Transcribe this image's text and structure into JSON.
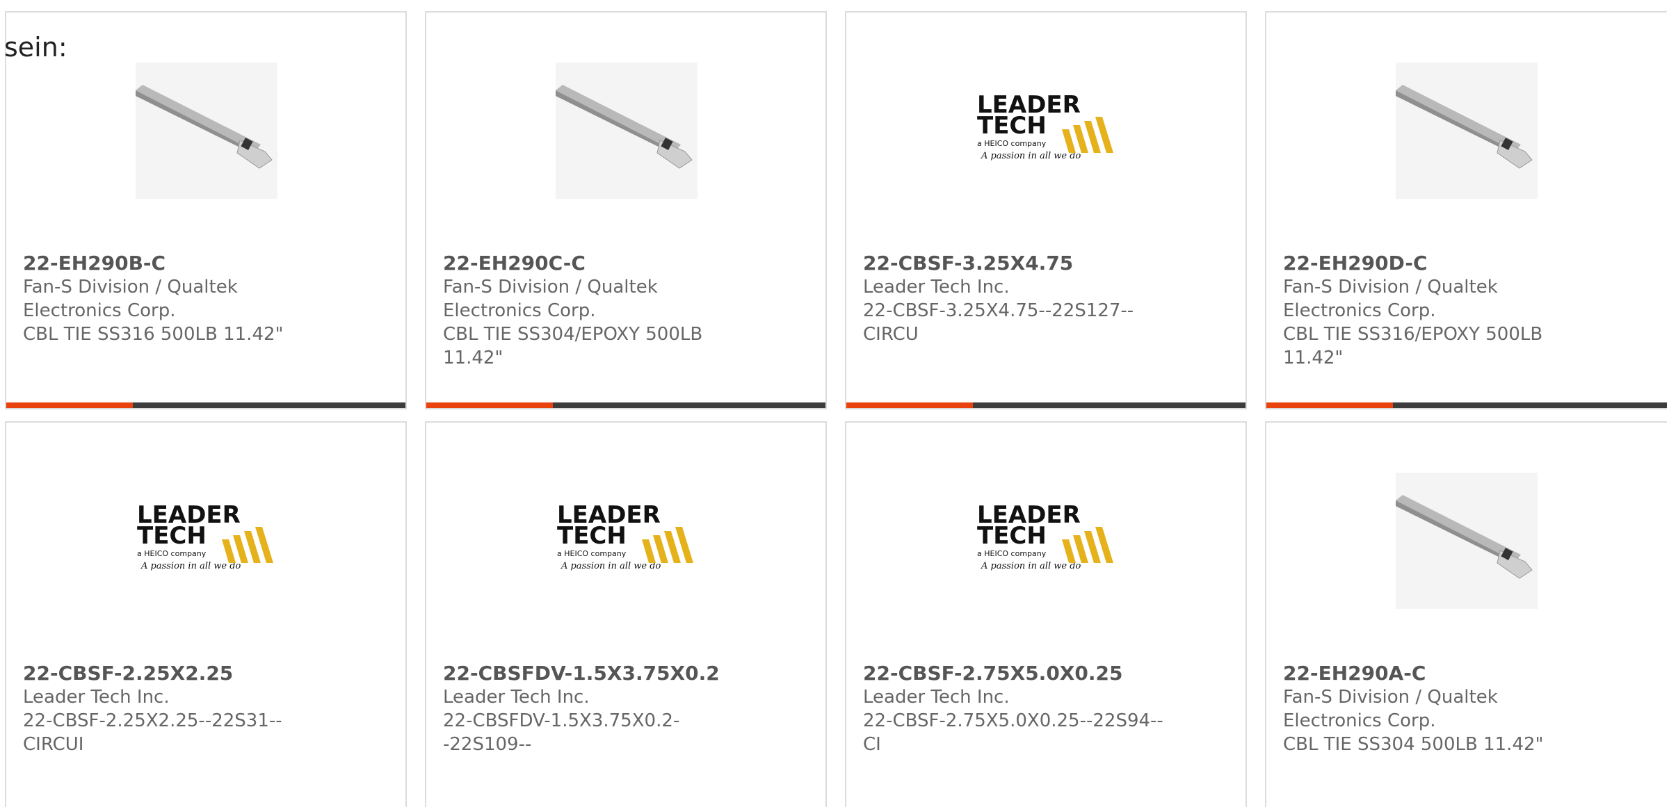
{
  "intro_text": "sein:",
  "colors": {
    "accent": "#e8420e",
    "bar": "#3c3c3c",
    "border": "#dcdcdc"
  },
  "cards": [
    {
      "part": "22-EH290B-C",
      "manufacturer": "Fan-S Division / Qualtek Electronics Corp.",
      "description": "CBL TIE SS316 500LB 11.42\"",
      "image": "cable-tie-photo"
    },
    {
      "part": "22-EH290C-C",
      "manufacturer": "Fan-S Division / Qualtek Electronics Corp.",
      "description": "CBL TIE SS304/EPOXY 500LB 11.42\"",
      "image": "cable-tie-photo"
    },
    {
      "part": "22-CBSF-3.25X4.75",
      "manufacturer": "Leader Tech Inc.",
      "description": "22-CBSF-3.25X4.75--22S127--CIRCU",
      "image": "leader-tech-logo"
    },
    {
      "part": "22-EH290D-C",
      "manufacturer": "Fan-S Division / Qualtek Electronics Corp.",
      "description": "CBL TIE SS316/EPOXY 500LB 11.42\"",
      "image": "cable-tie-photo"
    },
    {
      "part": "22-CBSF-2.25X2.25",
      "manufacturer": "Leader Tech Inc.",
      "description": "22-CBSF-2.25X2.25--22S31--CIRCUI",
      "image": "leader-tech-logo"
    },
    {
      "part": "22-CBSFDV-1.5X3.75X0.2",
      "manufacturer": "Leader Tech Inc.",
      "description": "22-CBSFDV-1.5X3.75X0.2--22S109--",
      "image": "leader-tech-logo"
    },
    {
      "part": "22-CBSF-2.75X5.0X0.25",
      "manufacturer": "Leader Tech Inc.",
      "description": "22-CBSF-2.75X5.0X0.25--22S94--CI",
      "image": "leader-tech-logo"
    },
    {
      "part": "22-EH290A-C",
      "manufacturer": "Fan-S Division / Qualtek Electronics Corp.",
      "description": "CBL TIE SS304 500LB 11.42\"",
      "image": "cable-tie-photo"
    }
  ],
  "logo_text": {
    "line1": "LEADER",
    "line2": "TECH",
    "line3": "a HEICO company",
    "tagline": "A passion in all we do"
  }
}
